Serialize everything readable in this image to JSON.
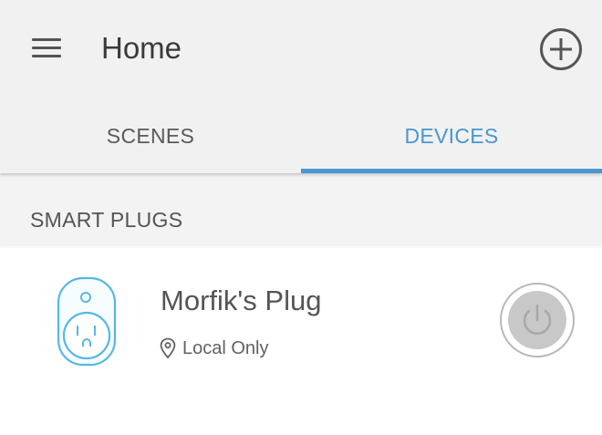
{
  "header": {
    "title": "Home"
  },
  "tabs": [
    {
      "label": "SCENES",
      "active": false
    },
    {
      "label": "DEVICES",
      "active": true
    }
  ],
  "section": {
    "title": "SMART PLUGS"
  },
  "devices": [
    {
      "name": "Morfik's Plug",
      "status": "Local Only",
      "icon": "smart-plug-icon",
      "power_state": "off"
    }
  ],
  "colors": {
    "accent": "#4a96cf",
    "header_bg": "#f1f1f1",
    "section_bg": "#f3f3f3",
    "power_button_fill": "#c8c8c8"
  }
}
